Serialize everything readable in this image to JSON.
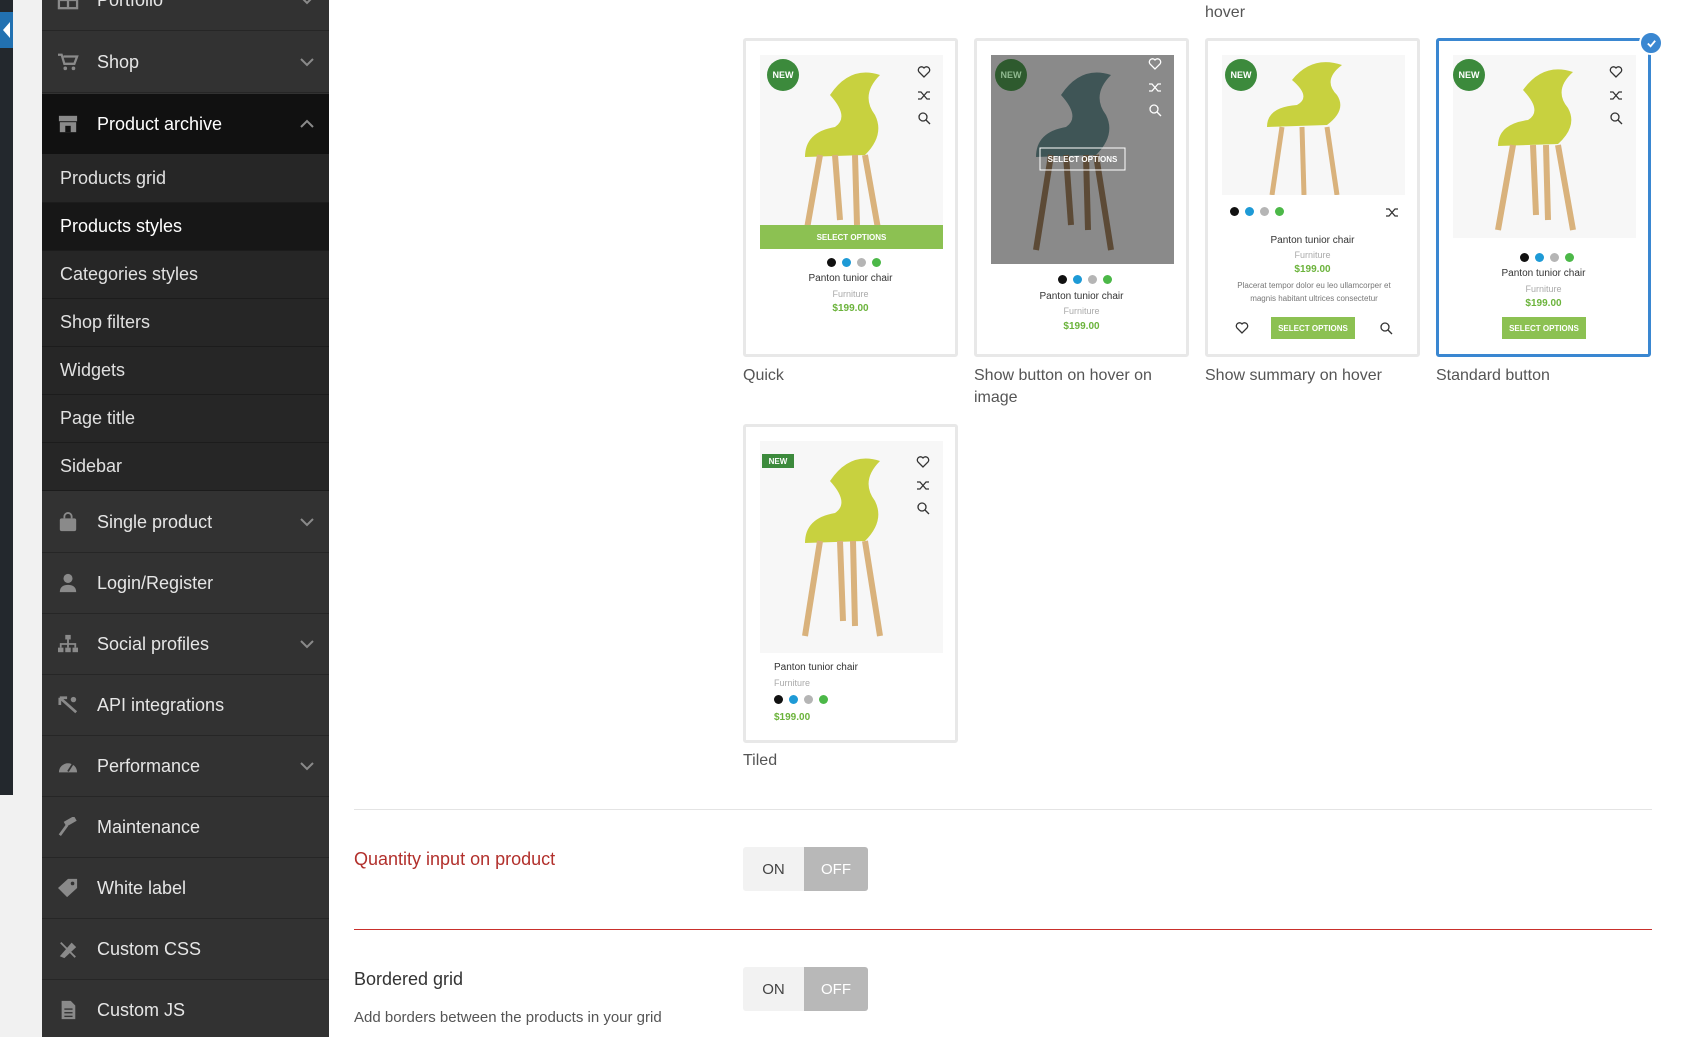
{
  "sidebar": {
    "items": [
      {
        "label": "Portfolio",
        "icon": "grid-icon"
      },
      {
        "label": "Shop",
        "icon": "cart-icon"
      },
      {
        "label": "Product archive",
        "icon": "store-icon"
      },
      {
        "label": "Single product",
        "icon": "bag-icon"
      },
      {
        "label": "Login/Register",
        "icon": "user-icon"
      },
      {
        "label": "Social profiles",
        "icon": "sitemap-icon"
      },
      {
        "label": "API integrations",
        "icon": "plug-icon"
      },
      {
        "label": "Performance",
        "icon": "gauge-icon"
      },
      {
        "label": "Maintenance",
        "icon": "hammer-icon"
      },
      {
        "label": "White label",
        "icon": "tag-icon"
      },
      {
        "label": "Custom CSS",
        "icon": "css-icon"
      },
      {
        "label": "Custom JS",
        "icon": "file-icon"
      }
    ],
    "subitems": [
      {
        "label": "Products grid"
      },
      {
        "label": "Products styles"
      },
      {
        "label": "Categories styles"
      },
      {
        "label": "Shop filters"
      },
      {
        "label": "Widgets"
      },
      {
        "label": "Page title"
      },
      {
        "label": "Sidebar"
      }
    ]
  },
  "main": {
    "top_caption": "hover",
    "styles": [
      {
        "label": "Quick"
      },
      {
        "label": "Show button on hover on image"
      },
      {
        "label": "Show summary on hover"
      },
      {
        "label": "Standard button"
      },
      {
        "label": "Tiled"
      }
    ],
    "product": {
      "name": "Panton tunior chair",
      "category": "Furniture",
      "price": "$199.00",
      "badge": "NEW",
      "button": "SELECT OPTIONS",
      "summary": "Placerat tempor dolor eu leo ullamcorper et magnis habitant ultrices consectetur",
      "swatch_colors": [
        "#111111",
        "#1e9ad6",
        "#b5b5b5",
        "#4cb848"
      ]
    },
    "options": {
      "quantity_input": {
        "title": "Quantity input on product",
        "on": "ON",
        "off": "OFF"
      },
      "bordered_grid": {
        "title": "Bordered grid",
        "description": "Add borders between the products in your grid",
        "on": "ON",
        "off": "OFF"
      }
    }
  },
  "colors": {
    "accent": "#3a87d1",
    "error_title": "#b2302c",
    "button_green": "#8cc152"
  }
}
